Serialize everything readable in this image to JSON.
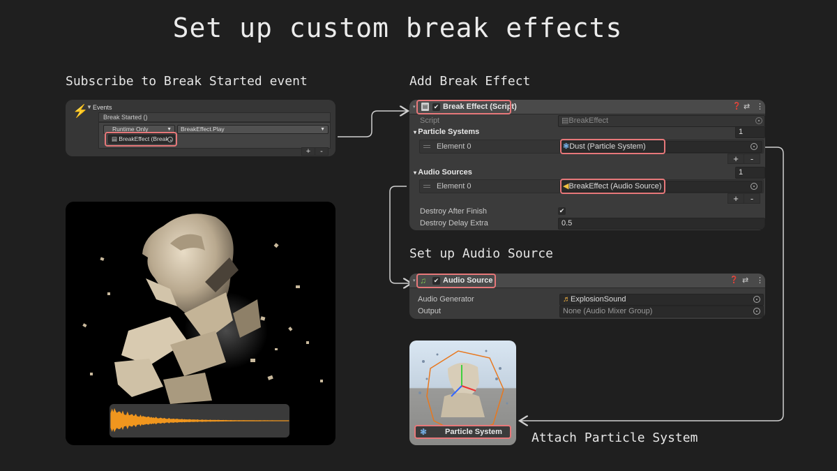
{
  "title": "Set up custom break effects",
  "sections": {
    "subscribe": "Subscribe to Break Started event",
    "add_effect": "Add Break Effect",
    "audio": "Set up Audio Source",
    "attach": "Attach Particle System"
  },
  "events_panel": {
    "header": "Events",
    "event_name": "Break Started ()",
    "runtime": "Runtime Only",
    "function": "BreakEffect.Play",
    "object": "BreakEffect (Break",
    "plus": "+",
    "minus": "-"
  },
  "break_effect": {
    "header": "Break Effect (Script)",
    "script_label": "Script",
    "script_value": "BreakEffect",
    "particle_systems_label": "Particle Systems",
    "particle_systems_count": "1",
    "element0": "Element 0",
    "dust_value": "Dust (Particle System)",
    "audio_sources_label": "Audio Sources",
    "audio_sources_count": "1",
    "audio_value": "BreakEffect (Audio Source)",
    "destroy_after_finish": "Destroy After Finish",
    "destroy_delay_extra": "Destroy Delay Extra",
    "destroy_delay_value": "0.5",
    "plus": "+",
    "minus": "-"
  },
  "audio_source": {
    "header": "Audio Source",
    "generator_label": "Audio Generator",
    "generator_value": "ExplosionSound",
    "output_label": "Output",
    "output_value": "None (Audio Mixer Group)"
  },
  "particle_thumb": {
    "label": "Particle System"
  },
  "colors": {
    "highlight": "#e7787a",
    "waveform": "#f0961e",
    "bg": "#1f1f1f",
    "panel": "#3b3b3b"
  }
}
